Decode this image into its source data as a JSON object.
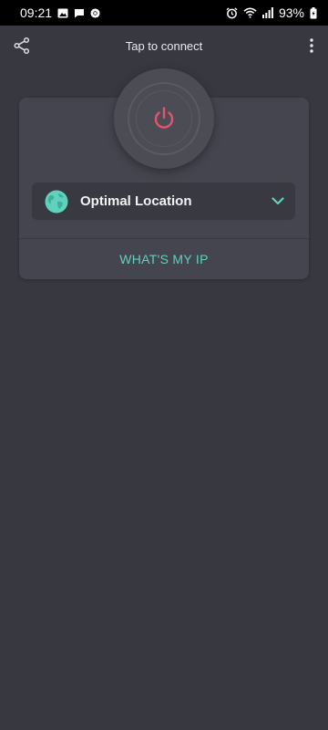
{
  "status_bar": {
    "time": "09:21",
    "battery": "93%",
    "left_icons": [
      "gallery-icon",
      "message-icon",
      "chrome-icon"
    ],
    "right_icons": [
      "alarm-icon",
      "wifi-icon",
      "signal-icon",
      "battery-icon"
    ]
  },
  "toolbar": {
    "title": "Tap to connect",
    "share_icon": "share-icon",
    "more_icon": "more-vert-icon"
  },
  "connect": {
    "power_icon": "power-icon",
    "power_color": "#e0566c"
  },
  "location": {
    "label": "Optimal Location",
    "globe_icon": "globe-icon",
    "chevron_icon": "chevron-down-icon",
    "accent": "#5fd1bd"
  },
  "whats_my_ip": {
    "label": "WHAT'S MY IP"
  }
}
